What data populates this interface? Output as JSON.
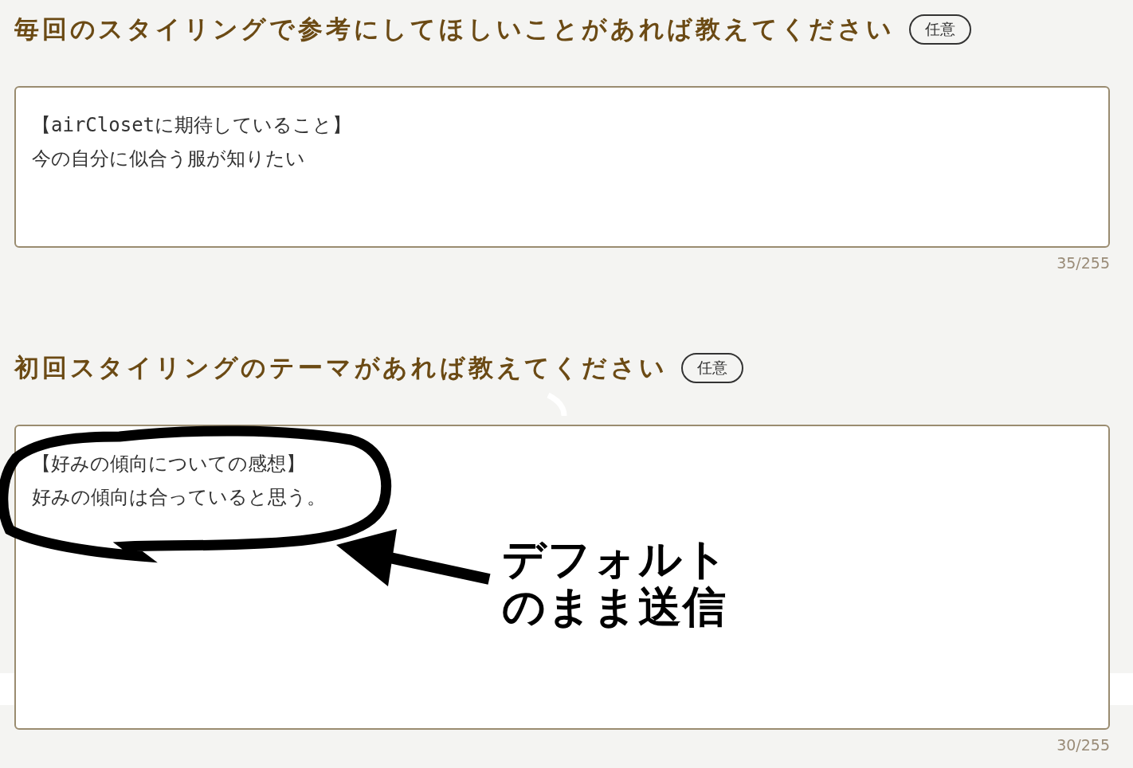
{
  "questions": [
    {
      "title": "毎回のスタイリングで参考にしてほしいことがあれば教えてください",
      "badge": "任意",
      "value_lines": [
        "【airClosetに期待していること】",
        "今の自分に似合う服が知りたい"
      ],
      "counter": "35/255"
    },
    {
      "title": "初回スタイリングのテーマがあれば教えてください",
      "badge": "任意",
      "value_lines": [
        "【好みの傾向についての感想】",
        "好みの傾向は合っていると思う。"
      ],
      "counter": "30/255"
    }
  ],
  "annotation": {
    "note_lines": [
      "デフォルト",
      "のまま送信"
    ]
  }
}
